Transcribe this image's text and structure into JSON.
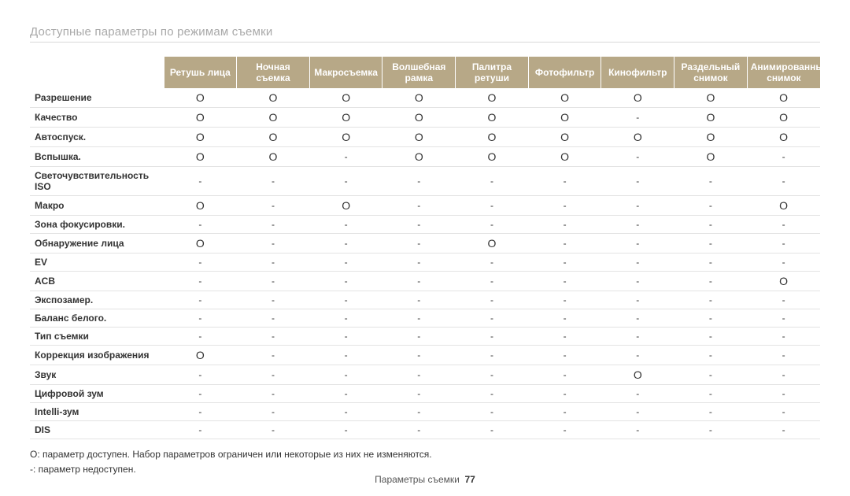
{
  "page": {
    "title": "Доступные параметры по режимам съемки",
    "footer_text": "Параметры съемки",
    "footer_page": "77"
  },
  "table": {
    "columns": [
      "Ретушь лица",
      "Ночная съемка",
      "Макросъемка",
      "Волшебная рамка",
      "Палитра ретуши",
      "Фотофильтр",
      "Кинофильтр",
      "Раздельный снимок",
      "Анимированный снимок"
    ],
    "rows": [
      {
        "label": "Разрешение",
        "v": [
          "O",
          "O",
          "O",
          "O",
          "O",
          "O",
          "O",
          "O",
          "O"
        ]
      },
      {
        "label": "Качество",
        "v": [
          "O",
          "O",
          "O",
          "O",
          "O",
          "O",
          "-",
          "O",
          "O"
        ]
      },
      {
        "label": "Автоспуск.",
        "v": [
          "O",
          "O",
          "O",
          "O",
          "O",
          "O",
          "O",
          "O",
          "O"
        ]
      },
      {
        "label": "Вспышка.",
        "v": [
          "O",
          "O",
          "-",
          "O",
          "O",
          "O",
          "-",
          "O",
          "-"
        ]
      },
      {
        "label": "Светочувствительность ISO",
        "v": [
          "-",
          "-",
          "-",
          "-",
          "-",
          "-",
          "-",
          "-",
          "-"
        ]
      },
      {
        "label": "Макро",
        "v": [
          "O",
          "-",
          "O",
          "-",
          "-",
          "-",
          "-",
          "-",
          "O"
        ]
      },
      {
        "label": "Зона фокусировки.",
        "v": [
          "-",
          "-",
          "-",
          "-",
          "-",
          "-",
          "-",
          "-",
          "-"
        ]
      },
      {
        "label": "Обнаружение лица",
        "v": [
          "O",
          "-",
          "-",
          "-",
          "O",
          "-",
          "-",
          "-",
          "-"
        ]
      },
      {
        "label": "EV",
        "v": [
          "-",
          "-",
          "-",
          "-",
          "-",
          "-",
          "-",
          "-",
          "-"
        ]
      },
      {
        "label": "ACB",
        "v": [
          "-",
          "-",
          "-",
          "-",
          "-",
          "-",
          "-",
          "-",
          "O"
        ]
      },
      {
        "label": "Экспозамер.",
        "v": [
          "-",
          "-",
          "-",
          "-",
          "-",
          "-",
          "-",
          "-",
          "-"
        ]
      },
      {
        "label": "Баланс белого.",
        "v": [
          "-",
          "-",
          "-",
          "-",
          "-",
          "-",
          "-",
          "-",
          "-"
        ]
      },
      {
        "label": "Тип съемки",
        "v": [
          "-",
          "-",
          "-",
          "-",
          "-",
          "-",
          "-",
          "-",
          "-"
        ]
      },
      {
        "label": "Коррекция изображения",
        "v": [
          "O",
          "-",
          "-",
          "-",
          "-",
          "-",
          "-",
          "-",
          "-"
        ]
      },
      {
        "label": "Звук",
        "v": [
          "-",
          "-",
          "-",
          "-",
          "-",
          "-",
          "O",
          "-",
          "-"
        ]
      },
      {
        "label": "Цифровой зум",
        "v": [
          "-",
          "-",
          "-",
          "-",
          "-",
          "-",
          "-",
          "-",
          "-"
        ]
      },
      {
        "label": "Intelli-зум",
        "v": [
          "-",
          "-",
          "-",
          "-",
          "-",
          "-",
          "-",
          "-",
          "-"
        ]
      },
      {
        "label": "DIS",
        "v": [
          "-",
          "-",
          "-",
          "-",
          "-",
          "-",
          "-",
          "-",
          "-"
        ]
      }
    ]
  },
  "footnote": {
    "line1": "O: параметр доступен. Набор параметров ограничен или некоторые из них не изменяются.",
    "line2": "-: параметр недоступен."
  }
}
